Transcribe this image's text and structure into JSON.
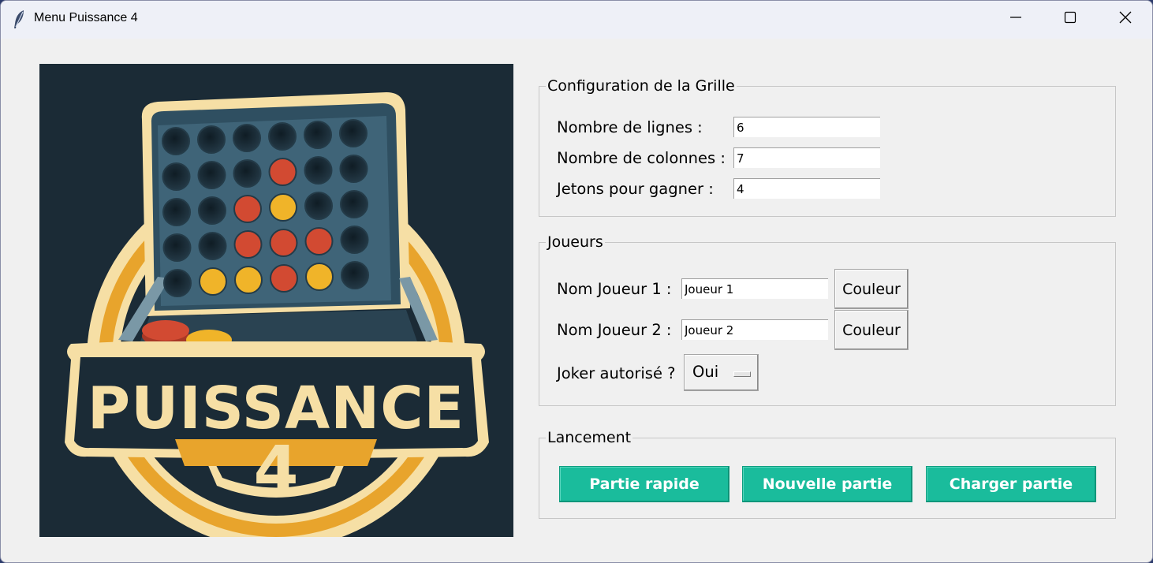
{
  "window": {
    "title": "Menu Puissance 4"
  },
  "logo": {
    "brand_text": "PUISSANCE",
    "brand_number": "4"
  },
  "grid_config": {
    "title": "Configuration de la Grille",
    "rows_label": "Nombre de lignes :",
    "rows_value": "6",
    "cols_label": "Nombre de colonnes :",
    "cols_value": "7",
    "win_label": "Jetons pour gagner :",
    "win_value": "4"
  },
  "players": {
    "title": "Joueurs",
    "p1_label": "Nom Joueur 1 :",
    "p1_value": "Joueur 1",
    "p2_label": "Nom Joueur 2 :",
    "p2_value": "Joueur 2",
    "color_button": "Couleur",
    "joker_label": "Joker autorisé ?",
    "joker_value": "Oui"
  },
  "launch": {
    "title": "Lancement",
    "quick": "Partie rapide",
    "new": "Nouvelle partie",
    "load": "Charger partie"
  },
  "colors": {
    "accent": "#1abc9c",
    "token_red": "#d24a32",
    "token_yellow": "#f0b429",
    "board": "#3f6478",
    "logo_bg": "#1b2b36",
    "logo_cream": "#f6dfa5"
  }
}
